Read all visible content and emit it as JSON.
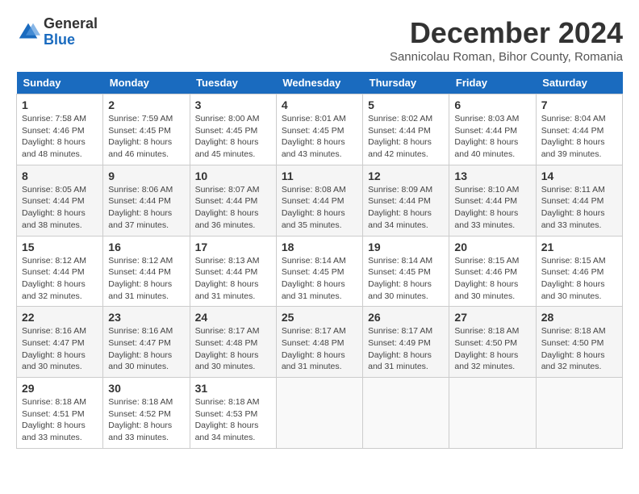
{
  "logo": {
    "general": "General",
    "blue": "Blue"
  },
  "header": {
    "month": "December 2024",
    "location": "Sannicolau Roman, Bihor County, Romania"
  },
  "weekdays": [
    "Sunday",
    "Monday",
    "Tuesday",
    "Wednesday",
    "Thursday",
    "Friday",
    "Saturday"
  ],
  "weeks": [
    [
      {
        "day": "1",
        "sunrise": "7:58 AM",
        "sunset": "4:46 PM",
        "daylight": "8 hours and 48 minutes."
      },
      {
        "day": "2",
        "sunrise": "7:59 AM",
        "sunset": "4:45 PM",
        "daylight": "8 hours and 46 minutes."
      },
      {
        "day": "3",
        "sunrise": "8:00 AM",
        "sunset": "4:45 PM",
        "daylight": "8 hours and 45 minutes."
      },
      {
        "day": "4",
        "sunrise": "8:01 AM",
        "sunset": "4:45 PM",
        "daylight": "8 hours and 43 minutes."
      },
      {
        "day": "5",
        "sunrise": "8:02 AM",
        "sunset": "4:44 PM",
        "daylight": "8 hours and 42 minutes."
      },
      {
        "day": "6",
        "sunrise": "8:03 AM",
        "sunset": "4:44 PM",
        "daylight": "8 hours and 40 minutes."
      },
      {
        "day": "7",
        "sunrise": "8:04 AM",
        "sunset": "4:44 PM",
        "daylight": "8 hours and 39 minutes."
      }
    ],
    [
      {
        "day": "8",
        "sunrise": "8:05 AM",
        "sunset": "4:44 PM",
        "daylight": "8 hours and 38 minutes."
      },
      {
        "day": "9",
        "sunrise": "8:06 AM",
        "sunset": "4:44 PM",
        "daylight": "8 hours and 37 minutes."
      },
      {
        "day": "10",
        "sunrise": "8:07 AM",
        "sunset": "4:44 PM",
        "daylight": "8 hours and 36 minutes."
      },
      {
        "day": "11",
        "sunrise": "8:08 AM",
        "sunset": "4:44 PM",
        "daylight": "8 hours and 35 minutes."
      },
      {
        "day": "12",
        "sunrise": "8:09 AM",
        "sunset": "4:44 PM",
        "daylight": "8 hours and 34 minutes."
      },
      {
        "day": "13",
        "sunrise": "8:10 AM",
        "sunset": "4:44 PM",
        "daylight": "8 hours and 33 minutes."
      },
      {
        "day": "14",
        "sunrise": "8:11 AM",
        "sunset": "4:44 PM",
        "daylight": "8 hours and 33 minutes."
      }
    ],
    [
      {
        "day": "15",
        "sunrise": "8:12 AM",
        "sunset": "4:44 PM",
        "daylight": "8 hours and 32 minutes."
      },
      {
        "day": "16",
        "sunrise": "8:12 AM",
        "sunset": "4:44 PM",
        "daylight": "8 hours and 31 minutes."
      },
      {
        "day": "17",
        "sunrise": "8:13 AM",
        "sunset": "4:44 PM",
        "daylight": "8 hours and 31 minutes."
      },
      {
        "day": "18",
        "sunrise": "8:14 AM",
        "sunset": "4:45 PM",
        "daylight": "8 hours and 31 minutes."
      },
      {
        "day": "19",
        "sunrise": "8:14 AM",
        "sunset": "4:45 PM",
        "daylight": "8 hours and 30 minutes."
      },
      {
        "day": "20",
        "sunrise": "8:15 AM",
        "sunset": "4:46 PM",
        "daylight": "8 hours and 30 minutes."
      },
      {
        "day": "21",
        "sunrise": "8:15 AM",
        "sunset": "4:46 PM",
        "daylight": "8 hours and 30 minutes."
      }
    ],
    [
      {
        "day": "22",
        "sunrise": "8:16 AM",
        "sunset": "4:47 PM",
        "daylight": "8 hours and 30 minutes."
      },
      {
        "day": "23",
        "sunrise": "8:16 AM",
        "sunset": "4:47 PM",
        "daylight": "8 hours and 30 minutes."
      },
      {
        "day": "24",
        "sunrise": "8:17 AM",
        "sunset": "4:48 PM",
        "daylight": "8 hours and 30 minutes."
      },
      {
        "day": "25",
        "sunrise": "8:17 AM",
        "sunset": "4:48 PM",
        "daylight": "8 hours and 31 minutes."
      },
      {
        "day": "26",
        "sunrise": "8:17 AM",
        "sunset": "4:49 PM",
        "daylight": "8 hours and 31 minutes."
      },
      {
        "day": "27",
        "sunrise": "8:18 AM",
        "sunset": "4:50 PM",
        "daylight": "8 hours and 32 minutes."
      },
      {
        "day": "28",
        "sunrise": "8:18 AM",
        "sunset": "4:50 PM",
        "daylight": "8 hours and 32 minutes."
      }
    ],
    [
      {
        "day": "29",
        "sunrise": "8:18 AM",
        "sunset": "4:51 PM",
        "daylight": "8 hours and 33 minutes."
      },
      {
        "day": "30",
        "sunrise": "8:18 AM",
        "sunset": "4:52 PM",
        "daylight": "8 hours and 33 minutes."
      },
      {
        "day": "31",
        "sunrise": "8:18 AM",
        "sunset": "4:53 PM",
        "daylight": "8 hours and 34 minutes."
      },
      null,
      null,
      null,
      null
    ]
  ]
}
